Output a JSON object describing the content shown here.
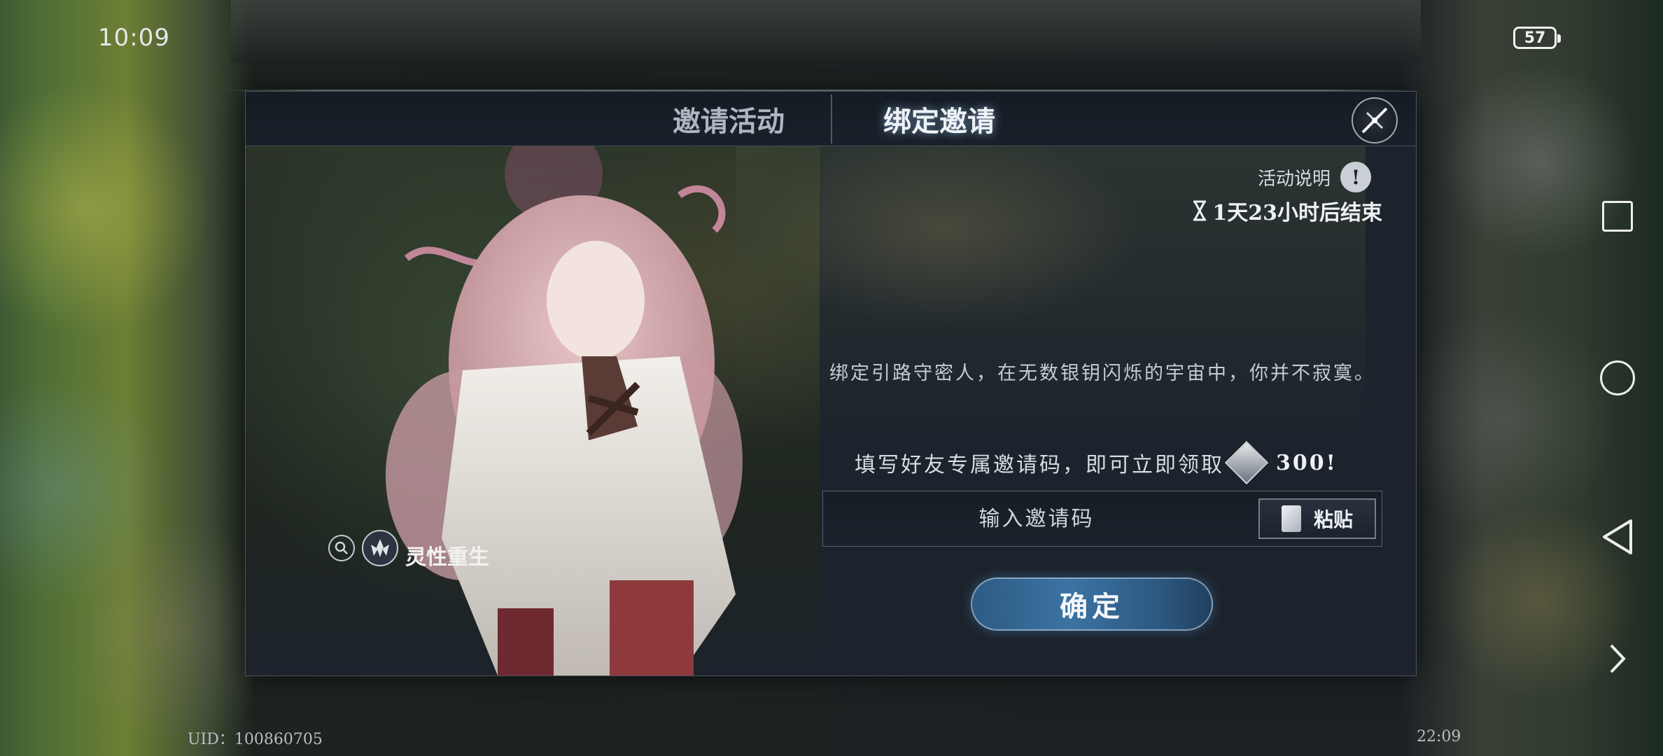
{
  "status_bar": {
    "time": "10:09",
    "battery": "57"
  },
  "dialog": {
    "tabs": [
      {
        "label": "邀请活动",
        "active": false
      },
      {
        "label": "绑定邀请",
        "active": true
      }
    ],
    "event_desc_label": "活动说明",
    "info_symbol": "!",
    "countdown": "1天23小时后结束",
    "character_tag": "灵性重生",
    "description": "绑定引路守密人，在无数银钥闪烁的宇宙中，你并不寂寞。",
    "reward_text": "填写好友专属邀请码，即可立即领取",
    "reward_amount": "300!",
    "code_input": {
      "placeholder": "输入邀请码",
      "value": ""
    },
    "paste_label": "粘贴",
    "confirm_label": "确定"
  },
  "footer": {
    "uid": "UID：100860705",
    "clock": "22:09"
  },
  "icons": [
    "close-icon",
    "hourglass-icon",
    "info-icon",
    "search-icon",
    "emblem-icon",
    "paste-icon",
    "reward-currency-icon",
    "square-nav-icon",
    "circle-nav-icon",
    "back-nav-icon",
    "chevron-right-icon"
  ],
  "colors": {
    "accent_blue": "#3c73a3",
    "panel": "#1c232c",
    "text_light": "#eef1f4"
  }
}
